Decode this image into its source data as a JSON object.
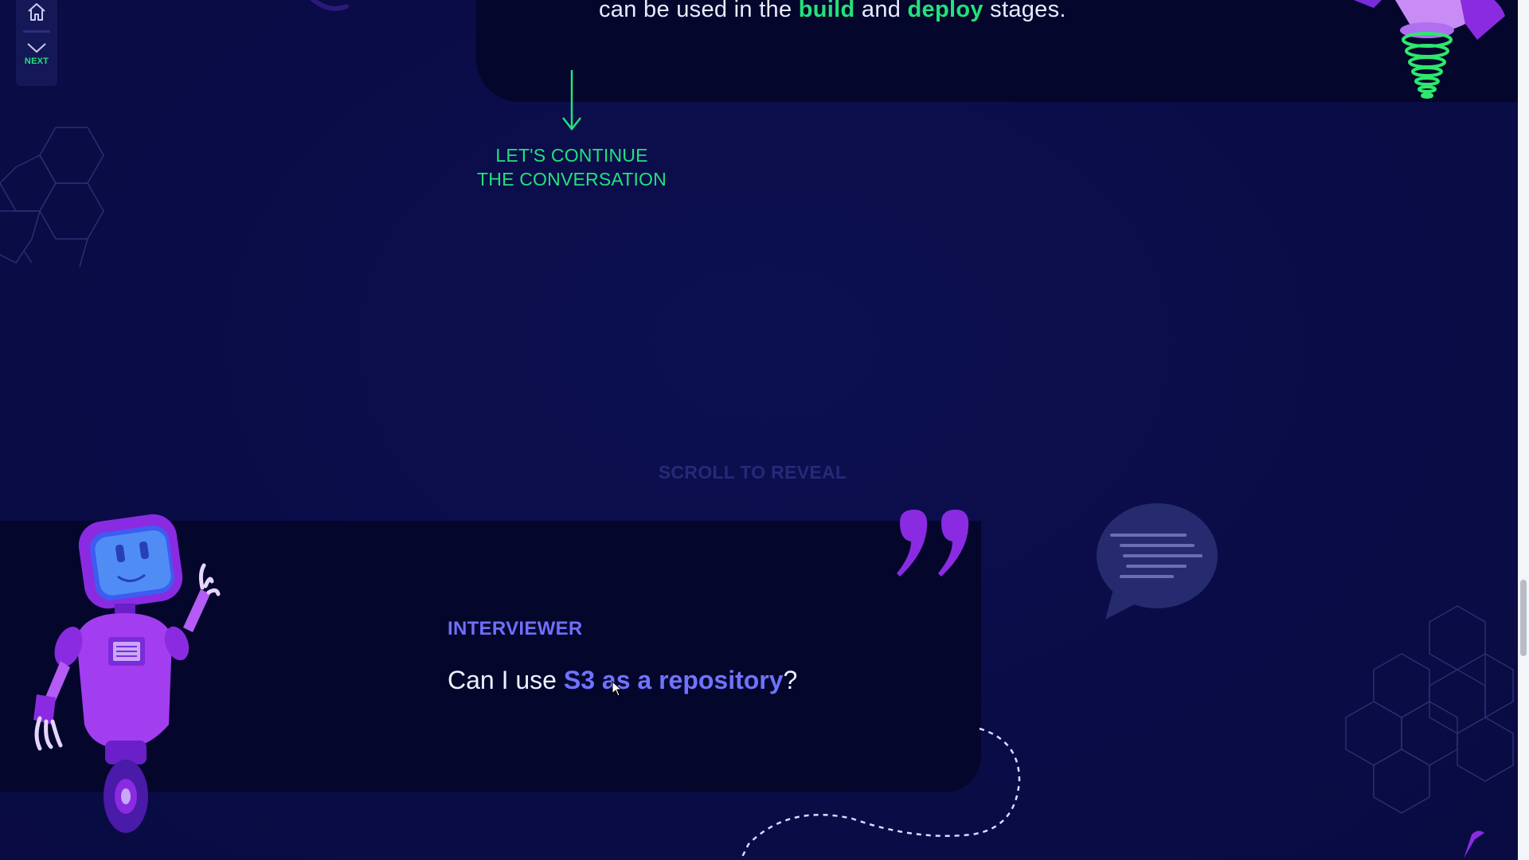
{
  "nav": {
    "home_icon": "home-icon",
    "next_icon": "chevron-down-icon",
    "next_label": "NEXT"
  },
  "answer": {
    "text_before": "can be used in the ",
    "highlight_1": "build",
    "text_middle": " and ",
    "highlight_2": "deploy",
    "text_after": " stages."
  },
  "continue": {
    "line1": "LET'S CONTINUE",
    "line2": "THE CONVERSATION",
    "arrow_icon": "arrow-down-icon"
  },
  "scroll_reveal": "SCROLL TO REVEAL",
  "question": {
    "role": "INTERVIEWER",
    "text_before": "Can I use ",
    "highlight": "S3 as a repository",
    "text_after": "?"
  },
  "colors": {
    "background": "#0a0c47",
    "card": "#05062b",
    "accent_green": "#22e27a",
    "accent_blue": "#6f73ff",
    "accent_purple": "#8a2be2"
  }
}
